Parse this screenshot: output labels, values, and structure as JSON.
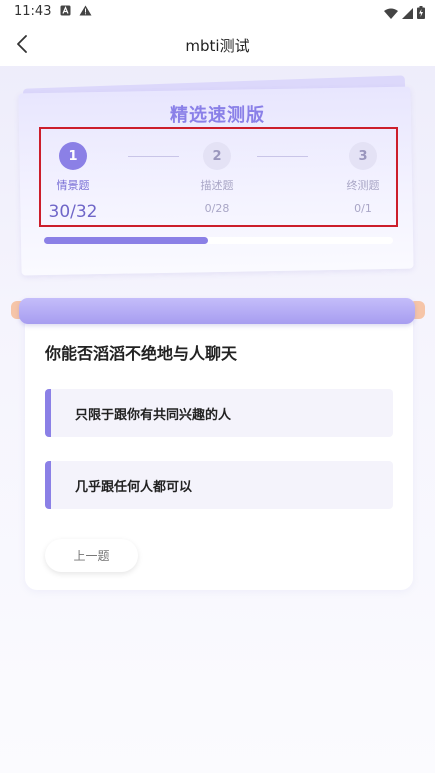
{
  "status_bar": {
    "time": "11:43",
    "icons": [
      "a-notification-icon",
      "warning-icon",
      "wifi-icon",
      "signal-icon",
      "battery-charging-icon"
    ]
  },
  "nav": {
    "title": "mbti测试",
    "back_icon": "chevron-left-icon"
  },
  "header_card": {
    "title": "精选速测版",
    "steps": [
      {
        "number": "1",
        "label": "情景题",
        "count": "30/32",
        "active": true
      },
      {
        "number": "2",
        "label": "描述题",
        "count": "0/28",
        "active": false
      },
      {
        "number": "3",
        "label": "终测题",
        "count": "0/1",
        "active": false
      }
    ],
    "progress_fraction": 0.47
  },
  "question": {
    "text": "你能否滔滔不绝地与人聊天",
    "options": [
      {
        "label": "只限于跟你有共同兴趣的人"
      },
      {
        "label": "几乎跟任何人都可以"
      }
    ],
    "prev_label": "上一题"
  },
  "colors": {
    "accent": "#8b80e6",
    "highlight_border": "#cc1e2b",
    "scroll_bar": "#a79df0",
    "scroll_end": "#f6c5a8"
  }
}
